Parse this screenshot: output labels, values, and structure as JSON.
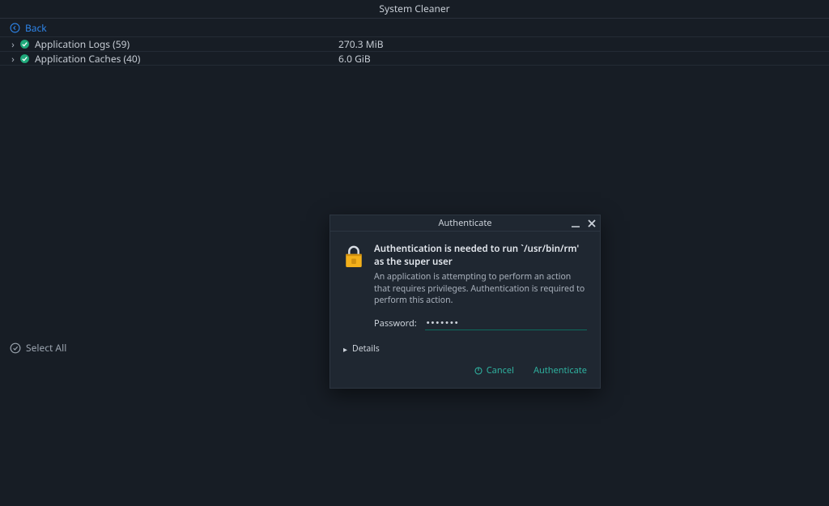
{
  "window": {
    "title": "System Cleaner"
  },
  "back": {
    "label": "Back"
  },
  "rows": [
    {
      "name": "Application Logs (59)",
      "size": "270.3 MiB"
    },
    {
      "name": "Application Caches (40)",
      "size": "6.0 GiB"
    }
  ],
  "select_all": {
    "label": "Select All"
  },
  "dialog": {
    "title": "Authenticate",
    "heading": "Authentication is needed to run `/usr/bin/rm' as the super user",
    "description": "An application is attempting to perform an action that requires privileges. Authentication is required to perform this action.",
    "password_label": "Password:",
    "password_value": "•••••••",
    "details_label": "Details",
    "cancel_label": "Cancel",
    "authenticate_label": "Authenticate"
  },
  "icons": {
    "back": "back-arrow-circle",
    "check": "check-circle",
    "lock": "lock",
    "minimize": "minimize",
    "close": "close",
    "cancel_glyph": "power"
  }
}
